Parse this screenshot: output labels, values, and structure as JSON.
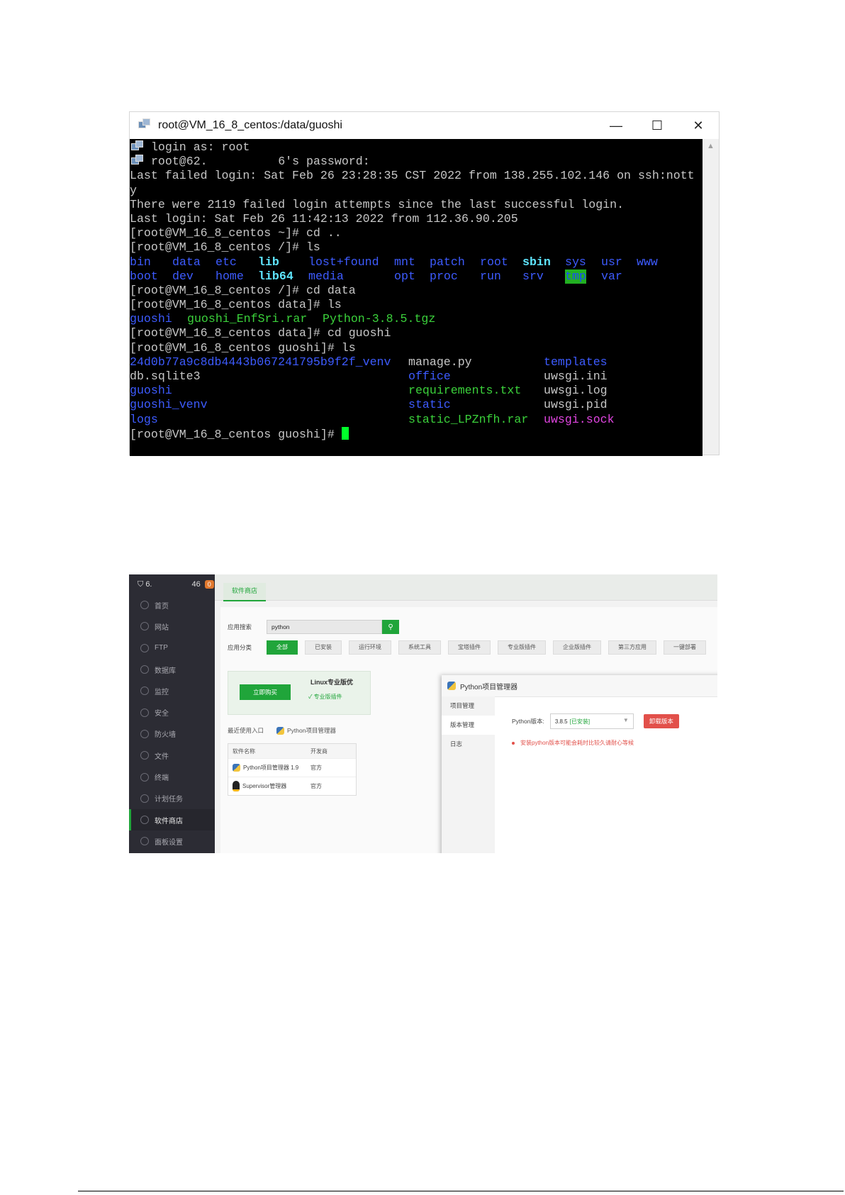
{
  "terminal": {
    "title": "root@VM_16_8_centos:/data/guoshi",
    "window_buttons": {
      "minimize": "—",
      "maximize": "☐",
      "close": "✕"
    },
    "lines": {
      "l1": "login as: root",
      "l2": "root@62.          6's password:",
      "l3": "Last failed login: Sat Feb 26 23:28:35 CST 2022 from 138.255.102.146 on ssh:nott",
      "l4": "y",
      "l5": "There were 2119 failed login attempts since the last successful login.",
      "l6": "Last login: Sat Feb 26 11:42:13 2022 from 112.36.90.205",
      "l7": "[root@VM_16_8_centos ~]# cd ..",
      "l8": "[root@VM_16_8_centos /]# ls",
      "l11": "[root@VM_16_8_centos /]# cd data",
      "l12": "[root@VM_16_8_centos data]# ls",
      "l14": "[root@VM_16_8_centos data]# cd guoshi",
      "l15": "[root@VM_16_8_centos guoshi]# ls",
      "l21": "[root@VM_16_8_centos guoshi]# "
    },
    "ls_root": {
      "row1": [
        "bin",
        "data",
        "etc",
        "lib",
        "lost+found",
        "mnt",
        "patch",
        "root",
        "sbin",
        "sys",
        "usr",
        "www"
      ],
      "row2": [
        "boot",
        "dev",
        "home",
        "lib64",
        "media",
        "opt",
        "proc",
        "run",
        "srv",
        "tmp",
        "var"
      ]
    },
    "ls_data": [
      "guoshi",
      "guoshi_EnfSri.rar",
      "Python-3.8.5.tgz"
    ],
    "ls_guoshi": {
      "col1": [
        "24d0b77a9c8db4443b067241795b9f2f_venv",
        "db.sqlite3",
        "guoshi",
        "guoshi_venv",
        "logs"
      ],
      "col2": [
        "manage.py",
        "office",
        "requirements.txt",
        "static",
        "static_LPZnfh.rar"
      ],
      "col3": [
        "templates",
        "uwsgi.ini",
        "uwsgi.log",
        "uwsgi.pid",
        "uwsgi.sock"
      ]
    }
  },
  "panel": {
    "header": {
      "ip": "6.",
      "count": "46",
      "badge": "0"
    },
    "sidebar": [
      "首页",
      "网站",
      "FTP",
      "数据库",
      "监控",
      "安全",
      "防火墙",
      "文件",
      "终端",
      "计划任务",
      "软件商店",
      "面板设置"
    ],
    "tab": "软件商店",
    "search_label": "应用搜索",
    "search_value": "python",
    "category_label": "应用分类",
    "categories": [
      "全部",
      "已安装",
      "运行环境",
      "系统工具",
      "宝塔插件",
      "专业版插件",
      "企业版插件",
      "第三方应用",
      "一键部署"
    ],
    "buy_button": "立即购买",
    "promo_title": "Linux专业版优",
    "promo_sub": "✓ 专业版插件",
    "recent_label": "最近使用入口",
    "recent_item": "Python项目管理器",
    "table_headers": [
      "软件名称",
      "开发商"
    ],
    "table_rows": [
      {
        "name": "Python项目管理器 1.9",
        "dev": "官方"
      },
      {
        "name": "Supervisor管理器",
        "dev": "官方"
      }
    ],
    "dialog": {
      "title": "Python项目管理器",
      "nav": [
        "项目管理",
        "版本管理",
        "日志"
      ],
      "version_label": "Python版本:",
      "version_value": "3.8.5",
      "version_status": "[已安装]",
      "uninstall_button": "卸载版本",
      "warning": "安装python版本可能会耗时比较久请耐心等候"
    }
  },
  "colors": {
    "terminal_bg": "#000000",
    "dir_blue": "#3d5bff",
    "symlink_cyan": "#5fe6ff",
    "archive_green": "#3bd13b",
    "socket_magenta": "#e045e0",
    "cursor": "#00ff2a",
    "brand_green": "#20a53a",
    "danger_red": "#e2504a"
  }
}
